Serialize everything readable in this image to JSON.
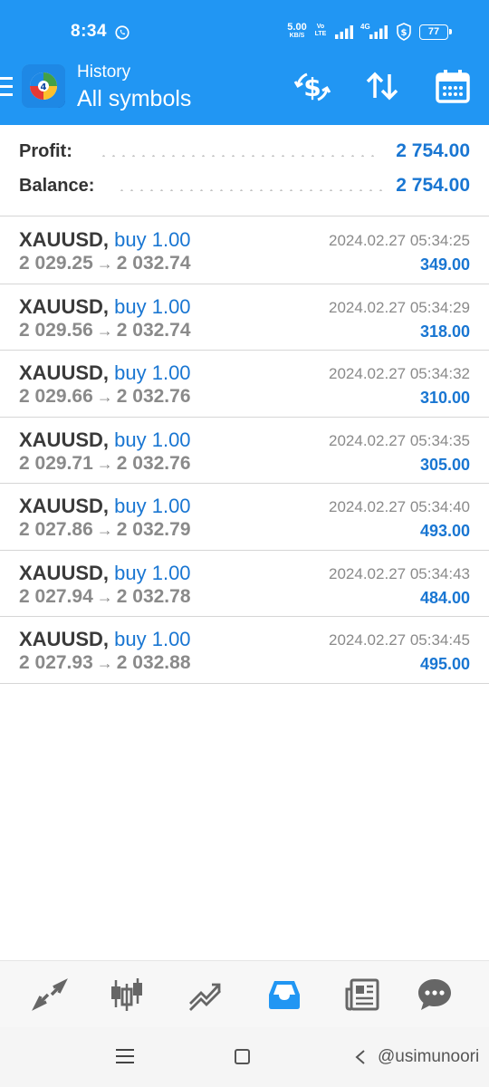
{
  "status_bar": {
    "time": "8:34",
    "net_speed": "5.00",
    "net_speed_unit": "KB/S",
    "volte_top": "Vo",
    "volte_bottom": "LTE",
    "network_type": "4G",
    "battery": "77"
  },
  "app_bar": {
    "title": "History",
    "subtitle": "All symbols"
  },
  "summary": {
    "profit_label": "Profit:",
    "profit_value": "2 754.00",
    "balance_label": "Balance:",
    "balance_value": "2 754.00"
  },
  "trades": [
    {
      "symbol": "XAUUSD,",
      "side": "buy 1.00",
      "open_price": "2 029.25",
      "close_price": "2 032.74",
      "arrow": "→",
      "time": "2024.02.27 05:34:25",
      "profit": "349.00"
    },
    {
      "symbol": "XAUUSD,",
      "side": "buy 1.00",
      "open_price": "2 029.56",
      "close_price": "2 032.74",
      "arrow": "→",
      "time": "2024.02.27 05:34:29",
      "profit": "318.00"
    },
    {
      "symbol": "XAUUSD,",
      "side": "buy 1.00",
      "open_price": "2 029.66",
      "close_price": "2 032.76",
      "arrow": "→",
      "time": "2024.02.27 05:34:32",
      "profit": "310.00"
    },
    {
      "symbol": "XAUUSD,",
      "side": "buy 1.00",
      "open_price": "2 029.71",
      "close_price": "2 032.76",
      "arrow": "→",
      "time": "2024.02.27 05:34:35",
      "profit": "305.00"
    },
    {
      "symbol": "XAUUSD,",
      "side": "buy 1.00",
      "open_price": "2 027.86",
      "close_price": "2 032.79",
      "arrow": "→",
      "time": "2024.02.27 05:34:40",
      "profit": "493.00"
    },
    {
      "symbol": "XAUUSD,",
      "side": "buy 1.00",
      "open_price": "2 027.94",
      "close_price": "2 032.78",
      "arrow": "→",
      "time": "2024.02.27 05:34:43",
      "profit": "484.00"
    },
    {
      "symbol": "XAUUSD,",
      "side": "buy 1.00",
      "open_price": "2 027.93",
      "close_price": "2 032.88",
      "arrow": "→",
      "time": "2024.02.27 05:34:45",
      "profit": "495.00"
    }
  ],
  "bottom_nav": {
    "items": [
      "trade-icon",
      "quotes-candles-icon",
      "chart-icon",
      "history-inbox-icon",
      "news-icon",
      "messages-icon"
    ],
    "active": "history-inbox-icon"
  },
  "watermark": "@usimunoori",
  "colors": {
    "primary": "#2196f3",
    "accent_text": "#1976d2",
    "muted_text": "#8a8a8a",
    "symbol_text": "#3a3a3a",
    "inactive_icon": "#666666"
  }
}
